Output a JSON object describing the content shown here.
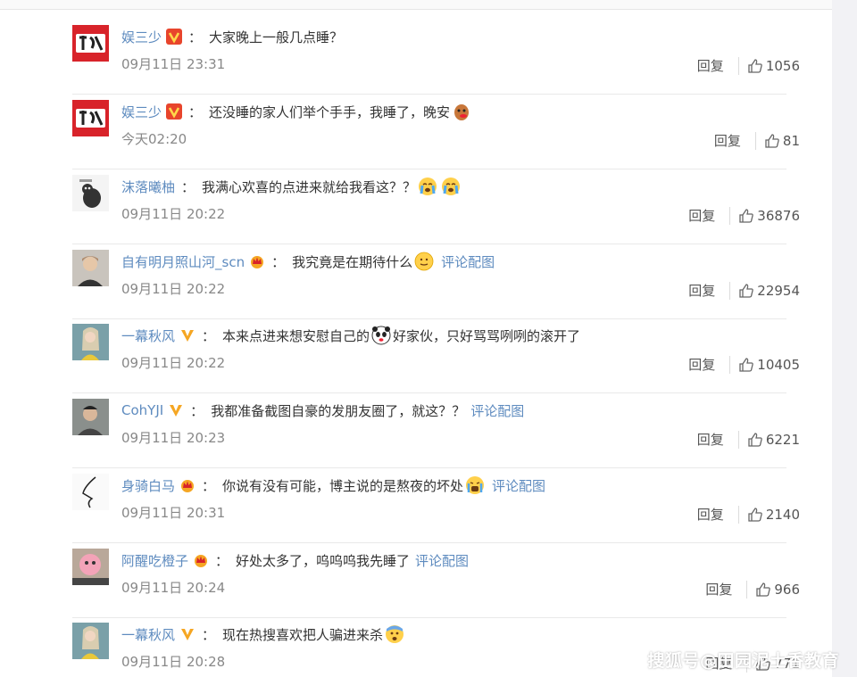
{
  "watermark": "搜狐号@田园泥土香教育",
  "comments": [
    {
      "username": "娱三少",
      "text": "大家晚上一般几点睡？",
      "time": "09月11日 23:31",
      "reply": "回复",
      "likes": "1056"
    },
    {
      "username": "娱三少",
      "text": "还没睡的家人们举个手手，我睡了，晚安",
      "time": "今天02:20",
      "reply": "回复",
      "likes": "81"
    },
    {
      "username": "沫落曦柚",
      "text": "我满心欢喜的点进来就给我看这？？",
      "time": "09月11日 20:22",
      "reply": "回复",
      "likes": "36876"
    },
    {
      "username": "自有明月照山河_scn",
      "text": "我究竟是在期待什么",
      "pic_link": "评论配图",
      "time": "09月11日 20:22",
      "reply": "回复",
      "likes": "22954"
    },
    {
      "username": "一幕秋风",
      "text_before": "本来点进来想安慰自己的",
      "text_after": "好家伙，只好骂骂咧咧的滚开了",
      "time": "09月11日 20:22",
      "reply": "回复",
      "likes": "10405"
    },
    {
      "username": "CohYJI",
      "text": "我都准备截图自豪的发朋友圈了，就这？？",
      "pic_link": "评论配图",
      "time": "09月11日 20:23",
      "reply": "回复",
      "likes": "6221"
    },
    {
      "username": "身骑白马",
      "text": "你说有没有可能，博主说的是熬夜的坏处",
      "pic_link": "评论配图",
      "time": "09月11日 20:31",
      "reply": "回复",
      "likes": "2140"
    },
    {
      "username": "阿醒吃橙子",
      "text": "好处太多了，呜呜呜我先睡了",
      "pic_link": "评论配图",
      "time": "09月11日 20:24",
      "reply": "回复",
      "likes": "966"
    },
    {
      "username": "一幕秋风",
      "text": "现在热搜喜欢把人骗进来杀",
      "time": "09月11日 20:28",
      "reply": "回复",
      "likes": "771"
    }
  ]
}
